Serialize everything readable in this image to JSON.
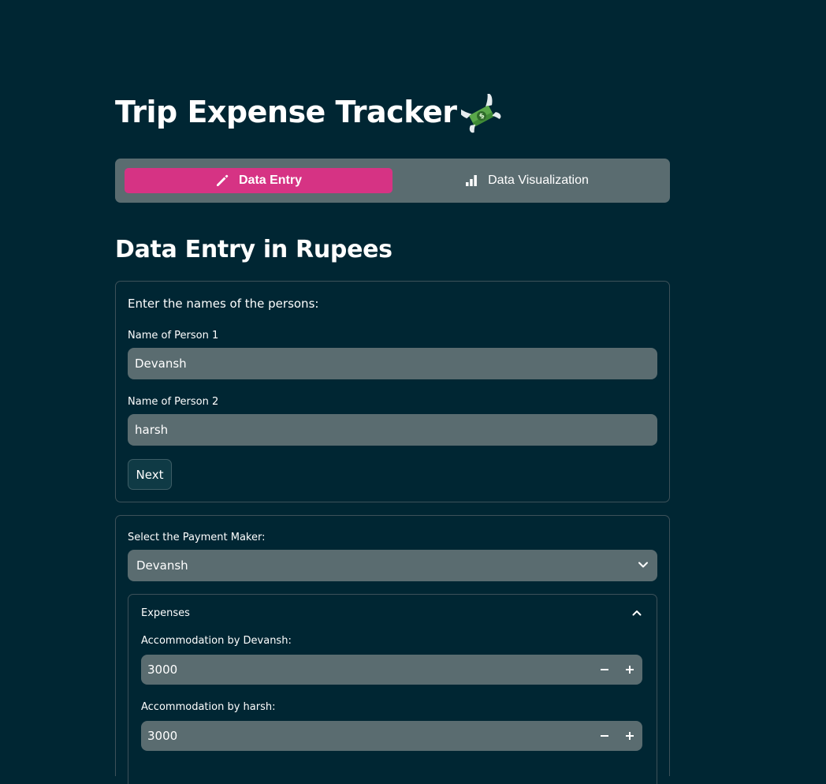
{
  "app": {
    "title": "Trip Expense Tracker",
    "title_emoji_icon": "money-with-wings-icon"
  },
  "colors": {
    "background": "#002633",
    "accent": "#d63384",
    "field": "#5a6c70"
  },
  "tabs": [
    {
      "label": "Data Entry",
      "icon": "pencil-icon",
      "active": true
    },
    {
      "label": "Data Visualization",
      "icon": "bar-chart-icon",
      "active": false
    }
  ],
  "section": {
    "heading": "Data Entry in Rupees"
  },
  "names_form": {
    "prompt": "Enter the names of the persons:",
    "person1_label": "Name of Person 1",
    "person1_value": "Devansh",
    "person2_label": "Name of Person 2",
    "person2_value": "harsh",
    "next_label": "Next"
  },
  "payment_form": {
    "maker_label": "Select the Payment Maker:",
    "maker_value": "Devansh",
    "expander": {
      "title": "Expenses",
      "expanded": true,
      "fields": [
        {
          "label": "Accommodation by Devansh:",
          "value": "3000"
        },
        {
          "label": "Accommodation by harsh:",
          "value": "3000"
        }
      ]
    }
  }
}
